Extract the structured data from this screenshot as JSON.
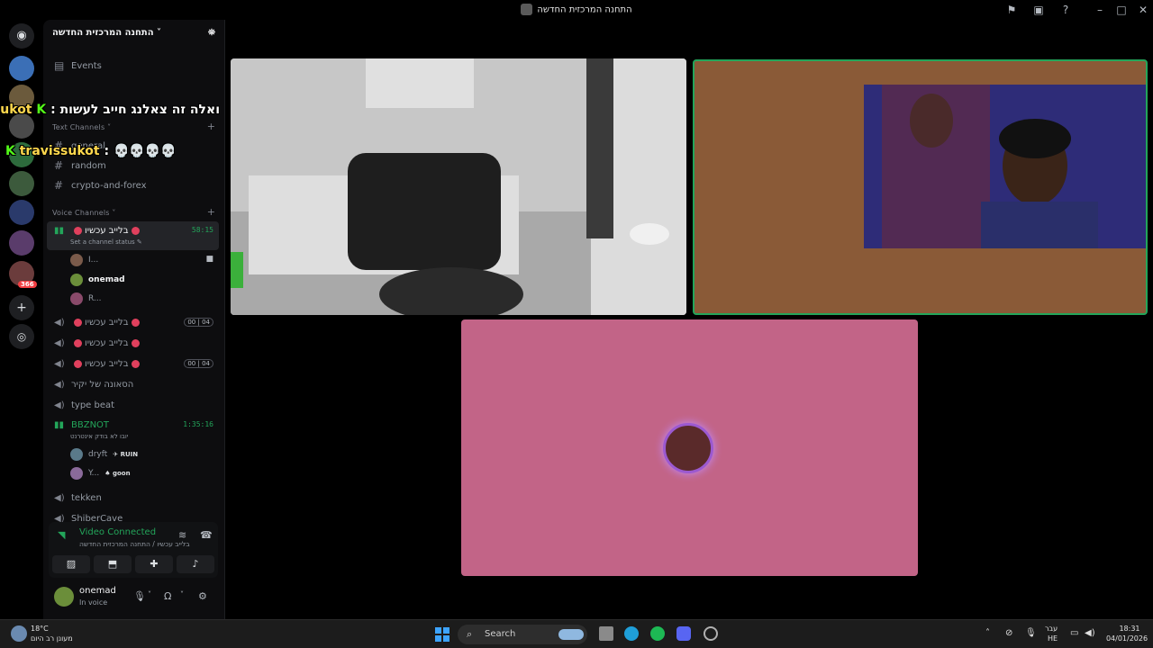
{
  "window": {
    "title": "התחנה המרכזית החדשה"
  },
  "server": {
    "name": "התחנה המרכזית החדשה",
    "events_label": "Events",
    "text_category": "Text Channels",
    "text_channels": [
      "general",
      "random",
      "crypto-and-forex"
    ],
    "voice_category": "Voice Channels",
    "active_voice": {
      "name": "בלייב עכשיו",
      "status": "Set a channel status",
      "timer": "58:15"
    },
    "active_members": [
      "I...",
      "onemad",
      "R..."
    ],
    "voice_channels": [
      {
        "name": "בלייב עכשיו",
        "badge_left": "00",
        "badge_right": "04"
      },
      {
        "name": "בלייב עכשיו"
      },
      {
        "name": "בלייב עכשיו",
        "badge_left": "00",
        "badge_right": "04"
      },
      {
        "name": "הסאונה של יקיר"
      },
      {
        "name": "type beat"
      }
    ],
    "bbznot": {
      "name": "BBZNOT",
      "status": "יובו לא בודק אינטרנט",
      "timer": "1:35:16",
      "members": [
        {
          "name": "dryft",
          "tag": "RUIN"
        },
        {
          "name": "Y...",
          "tag": "goon"
        }
      ]
    },
    "more_channels": [
      "tekken",
      "ShiberCave"
    ]
  },
  "overlay_chat": [
    {
      "badge": "K",
      "user": "travissukot",
      "text": "ואלה זה צאלנג חייב לעשות"
    },
    {
      "badge": "K",
      "user": "travissukot",
      "text": "💀💀💀💀"
    }
  ],
  "voice_panel": {
    "title": "Video Connected",
    "subtitle": "בלייב עכשיו / התחנה המרכזית החדשה"
  },
  "user": {
    "name": "onemad",
    "status": "In voice"
  },
  "server_badge": "366",
  "taskbar": {
    "weather_temp": "18°C",
    "weather_desc": "מעונן רב היום",
    "search_label": "Search",
    "lang_top": "עבר",
    "lang_bottom": "HE",
    "time": "18:31",
    "date": "04/01/2026"
  },
  "colors": {
    "accent_green": "#23a55a",
    "brown_tile": "#8a5a37",
    "pink_tile": "#c26487"
  }
}
